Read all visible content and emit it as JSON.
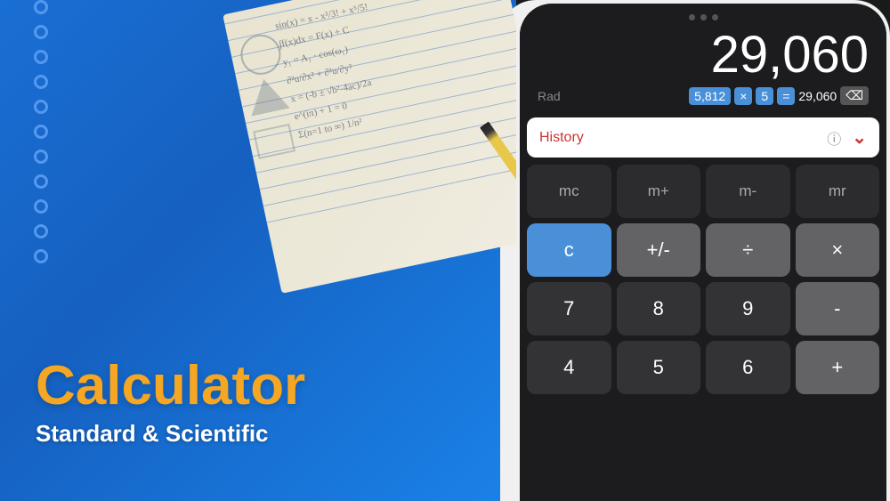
{
  "left": {
    "title": "Calculator",
    "subtitle": "Standard & Scientific"
  },
  "calculator": {
    "status_dots": [
      "dot1",
      "dot2",
      "dot3"
    ],
    "main_result": "29,060",
    "rad_label": "Rad",
    "expression": {
      "num1": "5,812",
      "op1": "×",
      "num2": "5",
      "eq": "=",
      "result": "29,060",
      "backspace": "⌫"
    },
    "history": {
      "label": "History",
      "info_icon": "ⓘ",
      "chevron": "⌄"
    },
    "buttons": [
      {
        "label": "mc",
        "type": "memory",
        "row": 1
      },
      {
        "label": "m+",
        "type": "memory",
        "row": 1
      },
      {
        "label": "m-",
        "type": "memory",
        "row": 1
      },
      {
        "label": "mr",
        "type": "memory",
        "row": 1
      },
      {
        "label": "c",
        "type": "blue",
        "row": 2
      },
      {
        "label": "+/-",
        "type": "mid",
        "row": 2
      },
      {
        "label": "÷",
        "type": "mid",
        "row": 2
      },
      {
        "label": "×",
        "type": "mid",
        "row": 2
      },
      {
        "label": "7",
        "type": "dark",
        "row": 3
      },
      {
        "label": "8",
        "type": "dark",
        "row": 3
      },
      {
        "label": "9",
        "type": "dark",
        "row": 3
      },
      {
        "label": "-",
        "type": "mid",
        "row": 3
      },
      {
        "label": "4",
        "type": "dark",
        "row": 4
      },
      {
        "label": "5",
        "type": "dark",
        "row": 4
      },
      {
        "label": "6",
        "type": "dark",
        "row": 4
      },
      {
        "label": "+",
        "type": "mid",
        "row": 4
      }
    ]
  }
}
